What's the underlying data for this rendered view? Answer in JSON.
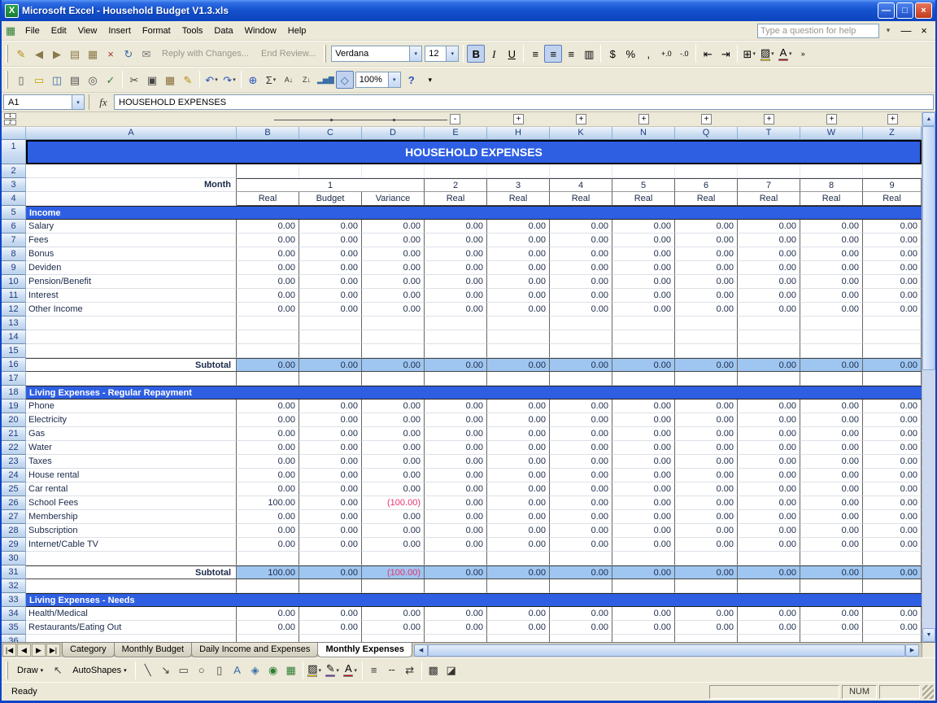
{
  "ui": {
    "dd": "▾",
    "up": "▲",
    "down": "▼",
    "left": "◀",
    "right": "▶"
  },
  "window": {
    "title": "Microsoft Excel - Household Budget V1.3.xls",
    "app_icon_glyph": "X",
    "controls": [
      {
        "name": "minimize-button",
        "glyph": "—"
      },
      {
        "name": "restore-button",
        "glyph": "□"
      },
      {
        "name": "close-button",
        "glyph": "×",
        "close": true
      }
    ]
  },
  "menu": {
    "workbook_icon_glyph": "▦",
    "items": [
      "File",
      "Edit",
      "View",
      "Insert",
      "Format",
      "Tools",
      "Data",
      "Window",
      "Help"
    ],
    "help_box_placeholder": "Type a question for help",
    "window_controls": [
      {
        "name": "minimize-workbook-button",
        "glyph": "—"
      },
      {
        "name": "close-workbook-button",
        "glyph": "×"
      }
    ]
  },
  "reviewing_toolbar": {
    "icons": [
      {
        "name": "edit-comment-icon",
        "glyph": "✎",
        "color": "#B8860B"
      },
      {
        "name": "previous-comment-icon",
        "glyph": "◀",
        "color": "#8A7A4A"
      },
      {
        "name": "next-comment-icon",
        "glyph": "▶",
        "color": "#8A7A4A"
      },
      {
        "name": "show-comment-icon",
        "glyph": "▤",
        "color": "#8A7A4A"
      },
      {
        "name": "show-all-comments-icon",
        "glyph": "▦",
        "color": "#8A7A4A"
      },
      {
        "name": "delete-comment-icon",
        "glyph": "×",
        "color": "#A33333"
      },
      {
        "name": "update-file-icon",
        "glyph": "↻",
        "color": "#3A6EA5"
      },
      {
        "name": "send-to-mail-recipient-icon",
        "glyph": "✉",
        "color": "#777777"
      }
    ],
    "reply_label": "Reply with Changes...",
    "end_review_label": "End Review..."
  },
  "formatting_toolbar": {
    "font_name": "Verdana",
    "font_size": "12",
    "buttons": [
      {
        "name": "bold-button",
        "glyph": "B",
        "pressed": true
      },
      {
        "name": "italic-button",
        "glyph": "I"
      },
      {
        "name": "underline-button",
        "glyph": "U"
      },
      {
        "type": "sep"
      },
      {
        "name": "align-left-button",
        "glyph": "≡"
      },
      {
        "name": "align-center-button",
        "glyph": "≡",
        "pressed": true
      },
      {
        "name": "align-right-button",
        "glyph": "≡"
      },
      {
        "name": "merge-and-center-button",
        "glyph": "▥"
      },
      {
        "type": "sep"
      },
      {
        "name": "currency-style-button",
        "glyph": "$"
      },
      {
        "name": "percent-style-button",
        "glyph": "%"
      },
      {
        "name": "comma-style-button",
        "glyph": ","
      },
      {
        "name": "increase-decimal-button",
        "glyph": "+.0",
        "small": true
      },
      {
        "name": "decrease-decimal-button",
        "glyph": "-.0",
        "small": true
      },
      {
        "type": "sep"
      },
      {
        "name": "decrease-indent-button",
        "glyph": "⇤"
      },
      {
        "name": "increase-indent-button",
        "glyph": "⇥"
      },
      {
        "type": "sep"
      },
      {
        "name": "borders-button",
        "glyph": "⊞",
        "dropdown": true
      },
      {
        "name": "fill-color-button",
        "glyph": "▨",
        "underbar": "#FFD700",
        "dropdown": true
      },
      {
        "name": "font-color-button",
        "glyph": "A",
        "underbar": "#CC0000",
        "dropdown": true
      },
      {
        "name": "toolbar-options-icon",
        "glyph": "»",
        "small": true
      }
    ]
  },
  "standard_toolbar": {
    "icons": [
      {
        "name": "new-workbook-icon",
        "glyph": "▯",
        "color": "#555555"
      },
      {
        "name": "open-icon",
        "glyph": "▭",
        "color": "#C8A200"
      },
      {
        "name": "save-icon",
        "glyph": "◫",
        "color": "#3A6EA5"
      },
      {
        "name": "print-icon",
        "glyph": "▤",
        "color": "#555555"
      },
      {
        "name": "print-preview-icon",
        "glyph": "◎",
        "color": "#555555"
      },
      {
        "name": "spelling-icon",
        "glyph": "✓",
        "color": "#2E7D32"
      },
      {
        "type": "sep"
      },
      {
        "name": "cut-icon",
        "glyph": "✂",
        "color": "#444444"
      },
      {
        "name": "copy-icon",
        "glyph": "▣",
        "color": "#444444"
      },
      {
        "name": "paste-icon",
        "glyph": "▦",
        "color": "#8A6D3B"
      },
      {
        "name": "format-painter-icon",
        "glyph": "✎",
        "color": "#B8860B"
      },
      {
        "type": "sep"
      },
      {
        "name": "undo-icon",
        "glyph": "↶",
        "color": "#2A52BE",
        "dropdown": true
      },
      {
        "name": "redo-icon",
        "glyph": "↷",
        "color": "#2A52BE",
        "dropdown": true
      },
      {
        "type": "sep"
      },
      {
        "name": "insert-hyperlink-icon",
        "glyph": "⊕",
        "color": "#2A52BE"
      },
      {
        "name": "autosum-icon",
        "glyph": "Σ",
        "color": "#333333",
        "dropdown": true
      },
      {
        "name": "sort-ascending-icon",
        "glyph": "A↓",
        "color": "#333333",
        "small": true
      },
      {
        "name": "sort-descending-icon",
        "glyph": "Z↓",
        "color": "#333333",
        "small": true
      },
      {
        "name": "chart-wizard-icon",
        "glyph": "▂▅▇",
        "color": "#3A6EA5",
        "small": true
      },
      {
        "name": "drawing-icon",
        "glyph": "◇",
        "color": "#3A6EA5",
        "pressed": true
      }
    ],
    "zoom": "100%",
    "help_glyph": "?"
  },
  "formula_bar": {
    "name_box": "A1",
    "fx_label": "fx",
    "formula": "HOUSEHOLD EXPENSES"
  },
  "sheet": {
    "outline": {
      "levels": [
        "1",
        "2"
      ],
      "collapse_label": "-",
      "expand_label": "+"
    },
    "columns": [
      "A",
      "B",
      "C",
      "D",
      "E",
      "H",
      "K",
      "N",
      "Q",
      "T",
      "W",
      "Z"
    ],
    "rows": [
      {
        "n": 1,
        "type": "title",
        "label": "HOUSEHOLD EXPENSES"
      },
      {
        "n": 2,
        "type": "blank",
        "plain": true
      },
      {
        "n": 3,
        "type": "month",
        "label": "Month",
        "months": [
          "1",
          "2",
          "3",
          "4",
          "5",
          "6",
          "7",
          "8",
          "9"
        ]
      },
      {
        "n": 4,
        "type": "subhead",
        "cells": [
          "Real",
          "Budget",
          "Variance",
          "Real",
          "Real",
          "Real",
          "Real",
          "Real",
          "Real",
          "Real",
          "Real"
        ]
      },
      {
        "n": 5,
        "type": "section",
        "label": "Income"
      },
      {
        "n": 6,
        "type": "data",
        "label": "Salary",
        "values": [
          "0.00",
          "0.00",
          "0.00",
          "0.00",
          "0.00",
          "0.00",
          "0.00",
          "0.00",
          "0.00",
          "0.00",
          "0.00"
        ]
      },
      {
        "n": 7,
        "type": "data",
        "label": "Fees",
        "values": [
          "0.00",
          "0.00",
          "0.00",
          "0.00",
          "0.00",
          "0.00",
          "0.00",
          "0.00",
          "0.00",
          "0.00",
          "0.00"
        ]
      },
      {
        "n": 8,
        "type": "data",
        "label": "Bonus",
        "values": [
          "0.00",
          "0.00",
          "0.00",
          "0.00",
          "0.00",
          "0.00",
          "0.00",
          "0.00",
          "0.00",
          "0.00",
          "0.00"
        ]
      },
      {
        "n": 9,
        "type": "data",
        "label": "Deviden",
        "values": [
          "0.00",
          "0.00",
          "0.00",
          "0.00",
          "0.00",
          "0.00",
          "0.00",
          "0.00",
          "0.00",
          "0.00",
          "0.00"
        ]
      },
      {
        "n": 10,
        "type": "data",
        "label": "Pension/Benefit",
        "values": [
          "0.00",
          "0.00",
          "0.00",
          "0.00",
          "0.00",
          "0.00",
          "0.00",
          "0.00",
          "0.00",
          "0.00",
          "0.00"
        ]
      },
      {
        "n": 11,
        "type": "data",
        "label": "Interest",
        "values": [
          "0.00",
          "0.00",
          "0.00",
          "0.00",
          "0.00",
          "0.00",
          "0.00",
          "0.00",
          "0.00",
          "0.00",
          "0.00"
        ]
      },
      {
        "n": 12,
        "type": "data",
        "label": "Other Income",
        "values": [
          "0.00",
          "0.00",
          "0.00",
          "0.00",
          "0.00",
          "0.00",
          "0.00",
          "0.00",
          "0.00",
          "0.00",
          "0.00"
        ]
      },
      {
        "n": 13,
        "type": "blank"
      },
      {
        "n": 14,
        "type": "blank"
      },
      {
        "n": 15,
        "type": "blank"
      },
      {
        "n": 16,
        "type": "subtotal",
        "label": "Subtotal",
        "values": [
          "0.00",
          "0.00",
          "0.00",
          "0.00",
          "0.00",
          "0.00",
          "0.00",
          "0.00",
          "0.00",
          "0.00",
          "0.00"
        ]
      },
      {
        "n": 17,
        "type": "blank"
      },
      {
        "n": 18,
        "type": "section",
        "label": "Living Expenses - Regular Repayment"
      },
      {
        "n": 19,
        "type": "data",
        "label": "Phone",
        "values": [
          "0.00",
          "0.00",
          "0.00",
          "0.00",
          "0.00",
          "0.00",
          "0.00",
          "0.00",
          "0.00",
          "0.00",
          "0.00"
        ]
      },
      {
        "n": 20,
        "type": "data",
        "label": "Electricity",
        "values": [
          "0.00",
          "0.00",
          "0.00",
          "0.00",
          "0.00",
          "0.00",
          "0.00",
          "0.00",
          "0.00",
          "0.00",
          "0.00"
        ]
      },
      {
        "n": 21,
        "type": "data",
        "label": "Gas",
        "values": [
          "0.00",
          "0.00",
          "0.00",
          "0.00",
          "0.00",
          "0.00",
          "0.00",
          "0.00",
          "0.00",
          "0.00",
          "0.00"
        ]
      },
      {
        "n": 22,
        "type": "data",
        "label": "Water",
        "values": [
          "0.00",
          "0.00",
          "0.00",
          "0.00",
          "0.00",
          "0.00",
          "0.00",
          "0.00",
          "0.00",
          "0.00",
          "0.00"
        ]
      },
      {
        "n": 23,
        "type": "data",
        "label": "Taxes",
        "values": [
          "0.00",
          "0.00",
          "0.00",
          "0.00",
          "0.00",
          "0.00",
          "0.00",
          "0.00",
          "0.00",
          "0.00",
          "0.00"
        ]
      },
      {
        "n": 24,
        "type": "data",
        "label": "House rental",
        "values": [
          "0.00",
          "0.00",
          "0.00",
          "0.00",
          "0.00",
          "0.00",
          "0.00",
          "0.00",
          "0.00",
          "0.00",
          "0.00"
        ]
      },
      {
        "n": 25,
        "type": "data",
        "label": "Car rental",
        "values": [
          "0.00",
          "0.00",
          "0.00",
          "0.00",
          "0.00",
          "0.00",
          "0.00",
          "0.00",
          "0.00",
          "0.00",
          "0.00"
        ]
      },
      {
        "n": 26,
        "type": "data",
        "label": "School Fees",
        "values": [
          "100.00",
          "0.00",
          "(100.00)",
          "0.00",
          "0.00",
          "0.00",
          "0.00",
          "0.00",
          "0.00",
          "0.00",
          "0.00"
        ]
      },
      {
        "n": 27,
        "type": "data",
        "label": "Membership",
        "values": [
          "0.00",
          "0.00",
          "0.00",
          "0.00",
          "0.00",
          "0.00",
          "0.00",
          "0.00",
          "0.00",
          "0.00",
          "0.00"
        ]
      },
      {
        "n": 28,
        "type": "data",
        "label": "Subscription",
        "values": [
          "0.00",
          "0.00",
          "0.00",
          "0.00",
          "0.00",
          "0.00",
          "0.00",
          "0.00",
          "0.00",
          "0.00",
          "0.00"
        ]
      },
      {
        "n": 29,
        "type": "data",
        "label": "Internet/Cable TV",
        "values": [
          "0.00",
          "0.00",
          "0.00",
          "0.00",
          "0.00",
          "0.00",
          "0.00",
          "0.00",
          "0.00",
          "0.00",
          "0.00"
        ]
      },
      {
        "n": 30,
        "type": "blank"
      },
      {
        "n": 31,
        "type": "subtotal",
        "label": "Subtotal",
        "values": [
          "100.00",
          "0.00",
          "(100.00)",
          "0.00",
          "0.00",
          "0.00",
          "0.00",
          "0.00",
          "0.00",
          "0.00",
          "0.00"
        ]
      },
      {
        "n": 32,
        "type": "blank"
      },
      {
        "n": 33,
        "type": "section",
        "label": "Living Expenses - Needs"
      },
      {
        "n": 34,
        "type": "data",
        "label": "Health/Medical",
        "values": [
          "0.00",
          "0.00",
          "0.00",
          "0.00",
          "0.00",
          "0.00",
          "0.00",
          "0.00",
          "0.00",
          "0.00",
          "0.00"
        ]
      },
      {
        "n": 35,
        "type": "data",
        "label": "Restaurants/Eating Out",
        "values": [
          "0.00",
          "0.00",
          "0.00",
          "0.00",
          "0.00",
          "0.00",
          "0.00",
          "0.00",
          "0.00",
          "0.00",
          "0.00"
        ]
      },
      {
        "n": 36,
        "type": "blank"
      }
    ]
  },
  "tab_bar": {
    "nav": [
      {
        "name": "first-sheet-button",
        "glyph": "|◀",
        "small": true
      },
      {
        "name": "prev-sheet-button",
        "glyph": "◀",
        "small": true
      },
      {
        "name": "next-sheet-button",
        "glyph": "▶",
        "small": true
      },
      {
        "name": "last-sheet-button",
        "glyph": "▶|",
        "small": true
      }
    ],
    "tabs": [
      {
        "label": "Category"
      },
      {
        "label": "Monthly Budget"
      },
      {
        "label": "Daily Income and Expenses"
      },
      {
        "label": "Monthly Expenses",
        "active": true
      }
    ]
  },
  "drawing_toolbar": {
    "draw_label": "Draw",
    "autoshapes_label": "AutoShapes",
    "select_icon": [
      {
        "name": "select-objects-icon",
        "glyph": "↖",
        "color": "#444444"
      }
    ],
    "icons": [
      {
        "name": "line-icon",
        "glyph": "╲",
        "color": "#444444"
      },
      {
        "name": "arrow-icon",
        "glyph": "↘",
        "color": "#444444"
      },
      {
        "name": "rectangle-icon",
        "glyph": "▭",
        "color": "#444444"
      },
      {
        "name": "oval-icon",
        "glyph": "○",
        "color": "#444444"
      },
      {
        "name": "text-box-icon",
        "glyph": "▯",
        "color": "#444444"
      },
      {
        "name": "insert-wordart-icon",
        "glyph": "A",
        "color": "#3A6EA5"
      },
      {
        "name": "insert-diagram-icon",
        "glyph": "◈",
        "color": "#3A6EA5"
      },
      {
        "name": "insert-clipart-icon",
        "glyph": "◉",
        "color": "#2E7D32"
      },
      {
        "name": "insert-picture-icon",
        "glyph": "▦",
        "color": "#2E7D32"
      },
      {
        "type": "sep"
      },
      {
        "name": "fill-color-icon",
        "glyph": "▨",
        "underbar": "#FFD700",
        "dropdown": true
      },
      {
        "name": "line-color-icon",
        "glyph": "✎",
        "underbar": "#7B2FBE",
        "dropdown": true
      },
      {
        "name": "font-color-icon",
        "glyph": "A",
        "underbar": "#CC0000",
        "dropdown": true
      },
      {
        "type": "sep"
      },
      {
        "name": "line-style-icon",
        "glyph": "≡",
        "color": "#333333"
      },
      {
        "name": "dash-style-icon",
        "glyph": "╌",
        "color": "#333333"
      },
      {
        "name": "arrow-style-icon",
        "glyph": "⇄",
        "color": "#333333"
      },
      {
        "type": "sep"
      },
      {
        "name": "shadow-style-icon",
        "glyph": "▩",
        "color": "#333333"
      },
      {
        "name": "3d-style-icon",
        "glyph": "◪",
        "color": "#333333"
      }
    ]
  },
  "status_bar": {
    "ready_label": "Ready",
    "num_label": "NUM"
  }
}
